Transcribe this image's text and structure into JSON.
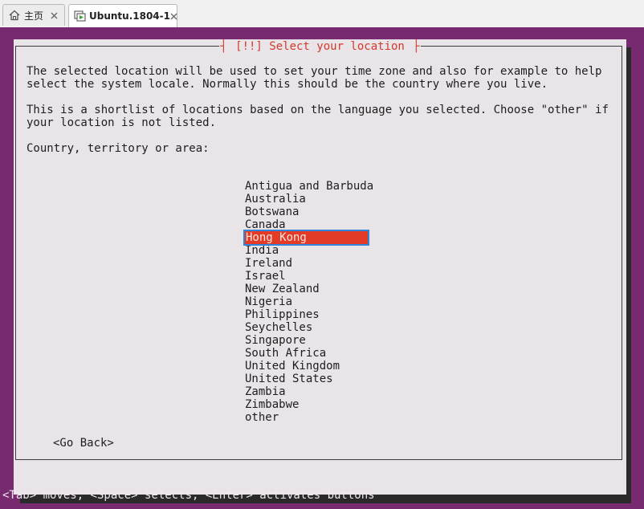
{
  "tabs": [
    {
      "label": "主页",
      "icon": "home-icon"
    },
    {
      "label": "Ubuntu.1804-1",
      "icon": "vm-icon"
    }
  ],
  "dialog": {
    "title": "[!!] Select your location",
    "paragraph1": [
      "The selected location will be used to set your time zone and also for example to help",
      "select the system locale. Normally this should be the country where you live."
    ],
    "paragraph2": [
      "This is a shortlist of locations based on the language you selected. Choose \"other\" if",
      "your location is not listed."
    ],
    "prompt": "Country, territory or area:",
    "countries": [
      "Antigua and Barbuda",
      "Australia",
      "Botswana",
      "Canada",
      "Hong Kong",
      "India",
      "Ireland",
      "Israel",
      "New Zealand",
      "Nigeria",
      "Philippines",
      "Seychelles",
      "Singapore",
      "South Africa",
      "United Kingdom",
      "United States",
      "Zambia",
      "Zimbabwe",
      "other"
    ],
    "selected": "Hong Kong",
    "back_button": "<Go Back>"
  },
  "status_line": "<Tab> moves; <Space> selects; <Enter> activates buttons",
  "colors": {
    "background_purple": "#772a70",
    "dialog_bg": "#e8e4e8",
    "title_red": "#d23a2a",
    "selection_red": "#e33b26",
    "focus_blue": "#2f86d8"
  }
}
